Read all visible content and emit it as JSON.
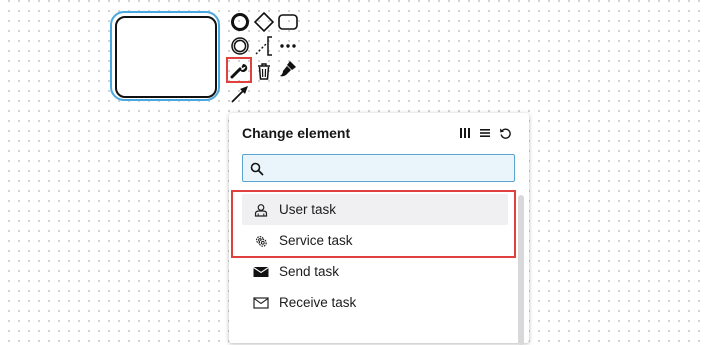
{
  "context_pad": {
    "entries": [
      {
        "name": "append-end-event",
        "icon": "circle-bold-icon"
      },
      {
        "name": "append-gateway",
        "icon": "diamond-icon"
      },
      {
        "name": "append-task",
        "icon": "rounded-rect-icon"
      },
      {
        "name": "append-intermediate-event",
        "icon": "double-circle-icon"
      },
      {
        "name": "append-text-annotation",
        "icon": "dashed-bracket-icon"
      },
      {
        "name": "more-options",
        "icon": "dots-icon"
      },
      {
        "name": "change-element",
        "icon": "wrench-icon",
        "highlighted": true
      },
      {
        "name": "delete",
        "icon": "trash-icon"
      },
      {
        "name": "set-color",
        "icon": "paint-brush-icon"
      },
      {
        "name": "connect",
        "icon": "arrow-icon"
      }
    ]
  },
  "popup": {
    "title": "Change element",
    "header_actions": [
      {
        "icon": "columns-icon"
      },
      {
        "icon": "list-icon"
      },
      {
        "icon": "reset-icon"
      }
    ],
    "search": {
      "value": "",
      "placeholder": ""
    },
    "items": [
      {
        "label": "User task",
        "icon": "user-task-icon",
        "active": true
      },
      {
        "label": "Service task",
        "icon": "gear-icon",
        "active": false
      },
      {
        "label": "Send task",
        "icon": "envelope-filled-icon",
        "active": false
      },
      {
        "label": "Receive task",
        "icon": "envelope-outline-icon",
        "active": false
      }
    ]
  },
  "colors": {
    "selection": "#4aa8e0",
    "highlight": "#e0413f",
    "search_border": "#5aa6cf",
    "search_bg": "#eaf5fb"
  }
}
